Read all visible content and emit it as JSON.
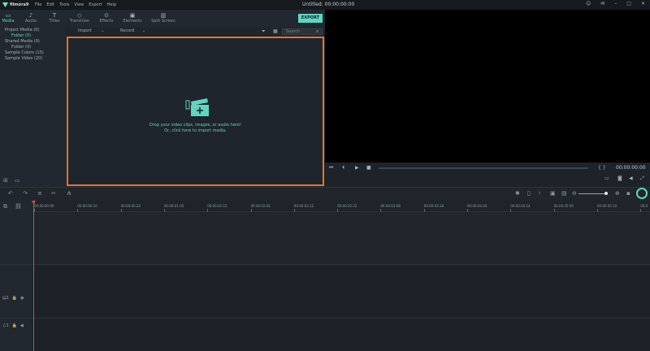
{
  "app": {
    "name": "filmora9",
    "title": "Untitled: 00:00:00:00",
    "menu": [
      "File",
      "Edit",
      "Tools",
      "View",
      "Export",
      "Help"
    ]
  },
  "tabs": [
    {
      "label": "Media",
      "icon": "folder-icon",
      "glyph": "▭"
    },
    {
      "label": "Audio",
      "icon": "music-icon",
      "glyph": "♪"
    },
    {
      "label": "Titles",
      "icon": "text-icon",
      "glyph": "T"
    },
    {
      "label": "Transition",
      "icon": "transition-icon",
      "glyph": "◇"
    },
    {
      "label": "Effects",
      "icon": "effects-icon",
      "glyph": "⊙"
    },
    {
      "label": "Elements",
      "icon": "elements-icon",
      "glyph": "▣"
    },
    {
      "label": "Split Screen",
      "icon": "split-screen-icon",
      "glyph": "▥"
    }
  ],
  "export_label": "EXPORT",
  "library": {
    "items": [
      {
        "label": "Project Media (0)",
        "indent": 0,
        "active": false
      },
      {
        "label": "Folder (0)",
        "indent": 1,
        "active": true
      },
      {
        "label": "Shared Media (0)",
        "indent": 0,
        "active": false
      },
      {
        "label": "Folder (0)",
        "indent": 1,
        "active": false
      },
      {
        "label": "Sample Colors (15)",
        "indent": 0,
        "active": false
      },
      {
        "label": "Sample Video (20)",
        "indent": 0,
        "active": false
      }
    ]
  },
  "media_bar": {
    "import_label": "Import",
    "record_label": "Record",
    "search_placeholder": "Search"
  },
  "drop_zone": {
    "line1": "Drop your video clips, images, or audio here!",
    "line2": "Or, click here to import media."
  },
  "player": {
    "timecode": "00:00:00:00"
  },
  "timeline": {
    "ticks": [
      "00:00:00:00",
      "00:00:00:10",
      "00:00:00:20",
      "00:00:01:05",
      "00:00:01:15",
      "00:00:02:01",
      "00:00:02:12",
      "00:00:02:22",
      "00:00:03:08",
      "00:00:03:18",
      "00:00:04:04",
      "00:00:04:14",
      "00:00:05:00",
      "00:00:05:10",
      "00:0"
    ],
    "tracks": [
      {
        "label": "1",
        "type": "video"
      },
      {
        "label": "1",
        "type": "audio"
      }
    ]
  },
  "colors": {
    "accent": "#5fd6bd",
    "highlight_border": "#e8742a",
    "playhead": "#e04545"
  }
}
